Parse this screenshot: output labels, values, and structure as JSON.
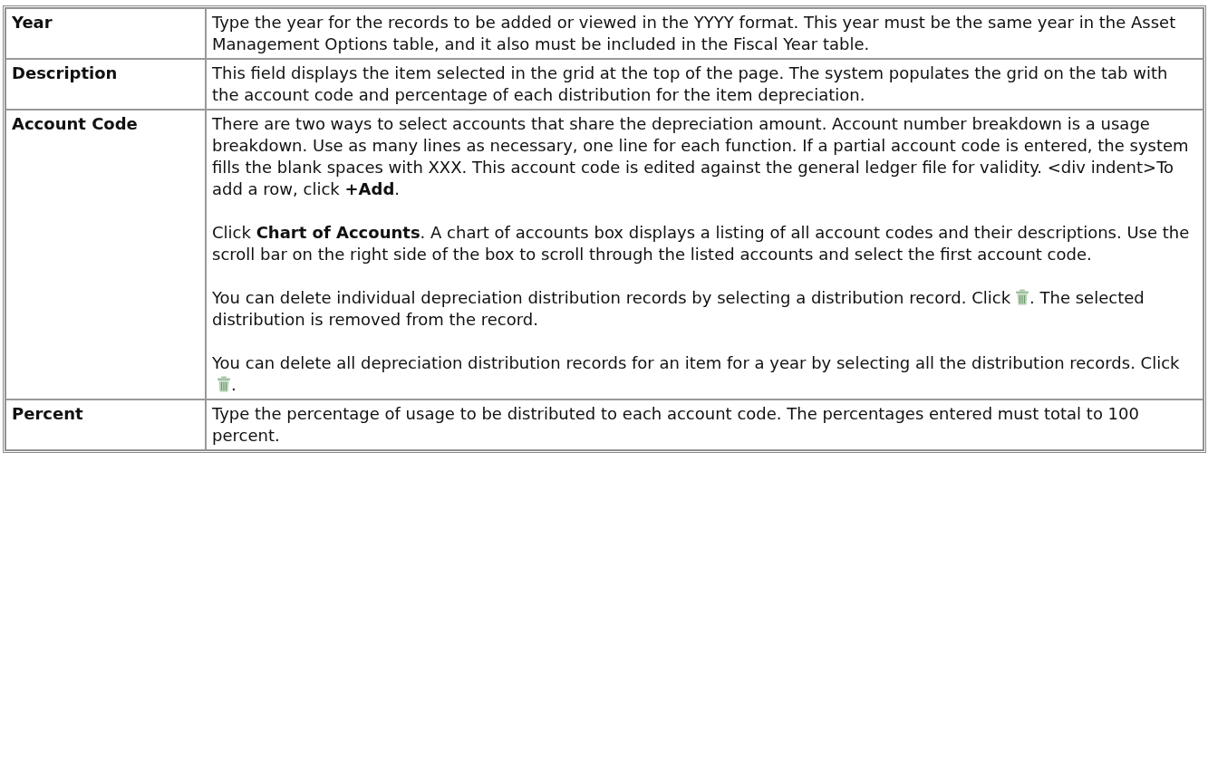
{
  "table": {
    "rows": [
      {
        "field": "Year",
        "paragraphs": [
          [
            {
              "kind": "text",
              "text": "Type the year for the records to be added or viewed in the YYYY format. This year must be the same year in the Asset Management Options table, and it also must be included in the Fiscal Year table."
            }
          ]
        ]
      },
      {
        "field": "Description",
        "paragraphs": [
          [
            {
              "kind": "text",
              "text": "This field displays the item selected in the grid at the top of the page. The system populates the grid on the tab with the account code and percentage of each distribution for the item depreciation."
            }
          ]
        ]
      },
      {
        "field": "Account Code",
        "paragraphs": [
          [
            {
              "kind": "text",
              "text": "There are two ways to select accounts that share the depreciation amount. Account number breakdown is a usage breakdown. Use as many lines as necessary, one line for each function. If a partial account code is entered, the system fills the blank spaces with XXX. This account code is edited against the general ledger file for validity. <div indent>To add a row, click **+Add**."
            }
          ],
          [
            {
              "kind": "text",
              "text": "Click **Chart of Accounts**. A chart of accounts box displays a listing of all account codes and their descriptions. Use the scroll bar on the right side of the box to scroll through the listed accounts and select the first account code."
            }
          ],
          [
            {
              "kind": "text",
              "text": "You can delete individual depreciation distribution records by selecting a distribution record. Click"
            },
            {
              "kind": "icon"
            },
            {
              "kind": "text",
              "text": ". The selected distribution is removed from the record."
            }
          ],
          [
            {
              "kind": "text",
              "text": "You can delete all depreciation distribution records for an item for a year by selecting all the distribution records. Click"
            },
            {
              "kind": "icon"
            },
            {
              "kind": "text",
              "text": "."
            }
          ]
        ]
      },
      {
        "field": "Percent",
        "paragraphs": [
          [
            {
              "kind": "text",
              "text": "Type the percentage of usage to be distributed to each account code. The percentages entered must total to 100 percent."
            }
          ]
        ]
      }
    ]
  }
}
